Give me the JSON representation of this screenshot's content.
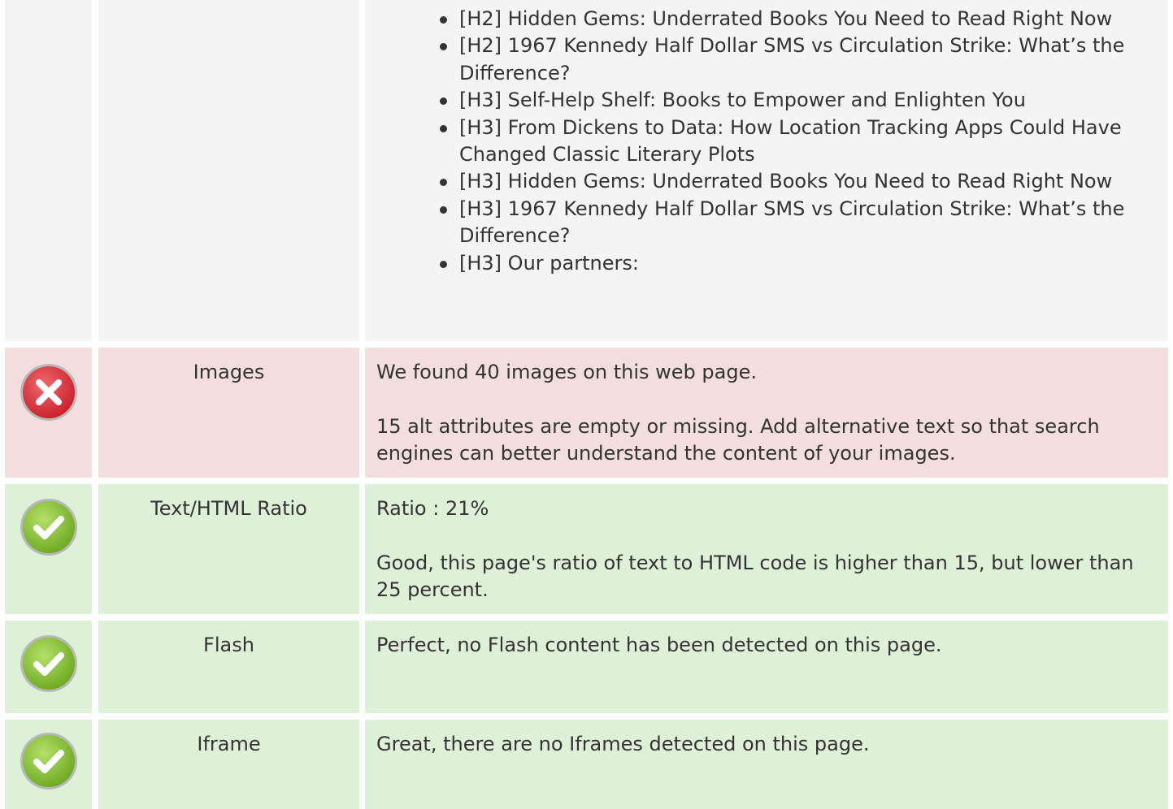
{
  "headings": {
    "items": [
      "[H2] Hidden Gems: Underrated Books You Need to Read Right Now",
      "[H2] 1967 Kennedy Half Dollar SMS vs Circulation Strike: What’s the Difference?",
      "[H3] Self-Help Shelf: Books to Empower and Enlighten You",
      "[H3] From Dickens to Data: How Location Tracking Apps Could Have Changed Classic Literary Plots",
      "[H3] Hidden Gems: Underrated Books You Need to Read Right Now",
      "[H3] 1967 Kennedy Half Dollar SMS vs Circulation Strike: What’s the Difference?",
      "[H3] Our partners:"
    ]
  },
  "checks": {
    "images": {
      "status": "error",
      "status_icon": "error-x-icon",
      "label": "Images",
      "lines": [
        "We found 40 images on this web page.",
        "15 alt attributes are empty or missing. Add alternative text so that search engines can better understand the content of your images."
      ]
    },
    "ratio": {
      "status": "ok",
      "status_icon": "check-icon",
      "label": "Text/HTML Ratio",
      "lines": [
        "Ratio : 21%",
        "Good, this page's ratio of text to HTML code is higher than 15, but lower than 25 percent."
      ]
    },
    "flash": {
      "status": "ok",
      "status_icon": "check-icon",
      "label": "Flash",
      "lines": [
        "Perfect, no Flash content has been detected on this page."
      ]
    },
    "iframe": {
      "status": "ok",
      "status_icon": "check-icon",
      "label": "Iframe",
      "lines": [
        "Great, there are no Iframes detected on this page."
      ]
    }
  },
  "colors": {
    "neutral_bg": "#f4f4f4",
    "error_bg": "#f2dede",
    "success_bg": "#dff0d8",
    "error_icon": "#d9303a",
    "success_icon": "#8cc63f",
    "text": "#333333"
  }
}
